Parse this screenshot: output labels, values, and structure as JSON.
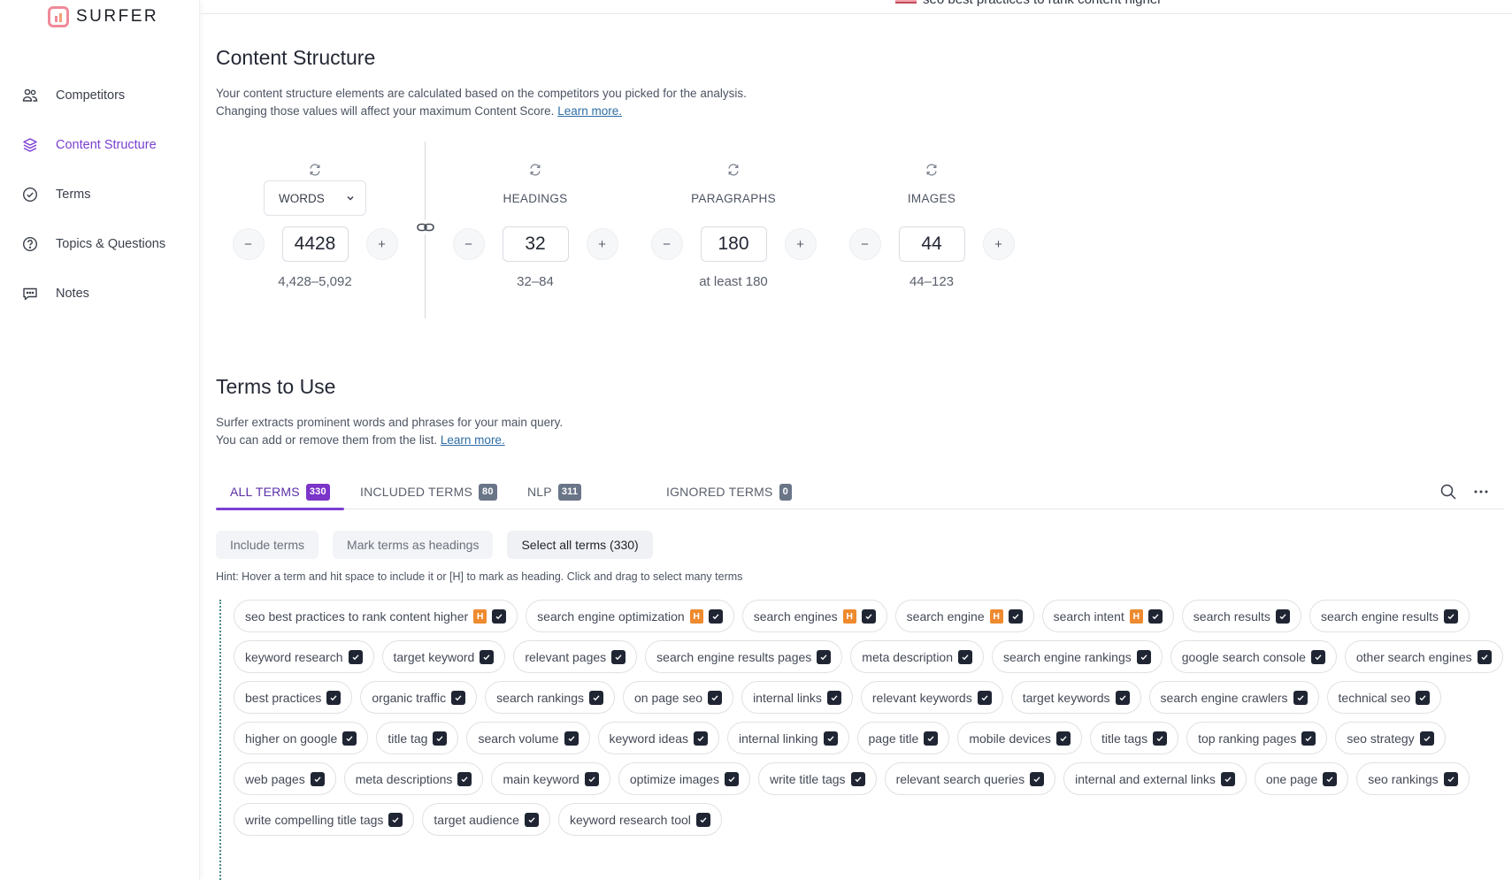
{
  "app": {
    "name": "SURFER"
  },
  "header": {
    "query": "seo best practices to rank content higher"
  },
  "sidebar": {
    "items": [
      {
        "label": "Competitors",
        "icon": "users-icon",
        "active": false
      },
      {
        "label": "Content Structure",
        "icon": "layers-icon",
        "active": true
      },
      {
        "label": "Terms",
        "icon": "check-circle-icon",
        "active": false
      },
      {
        "label": "Topics & Questions",
        "icon": "question-circle-icon",
        "active": false
      },
      {
        "label": "Notes",
        "icon": "chat-icon",
        "active": false
      }
    ]
  },
  "structure": {
    "title": "Content Structure",
    "desc_line1": "Your content structure elements are calculated based on the competitors you picked for the analysis.",
    "desc_line2": "Changing those values will affect your maximum Content Score.",
    "learn_more": "Learn more.",
    "metrics": [
      {
        "label": "WORDS",
        "is_select": true,
        "value": "4428",
        "range": "4,428–5,092"
      },
      {
        "label": "HEADINGS",
        "is_select": false,
        "value": "32",
        "range": "32–84"
      },
      {
        "label": "PARAGRAPHS",
        "is_select": false,
        "value": "180",
        "range": "at least 180"
      },
      {
        "label": "IMAGES",
        "is_select": false,
        "value": "44",
        "range": "44–123"
      }
    ],
    "minus": "−",
    "plus": "+"
  },
  "terms_section": {
    "title": "Terms to Use",
    "desc_line1": "Surfer extracts prominent words and phrases for your main query.",
    "desc_line2": "You can add or remove them from the list.",
    "learn_more": "Learn more.",
    "tabs": [
      {
        "label": "ALL TERMS",
        "count": "330",
        "active": true
      },
      {
        "label": "INCLUDED TERMS",
        "count": "80",
        "active": false
      },
      {
        "label": "NLP",
        "count": "311",
        "active": false
      },
      {
        "label": "IGNORED TERMS",
        "count": "0",
        "active": false
      }
    ],
    "actions": {
      "include": "Include terms",
      "mark_headings": "Mark terms as headings",
      "select_all": "Select all terms (330)"
    },
    "hint": "Hint: Hover a term and hit space to include it or [H] to mark as heading. Click and drag to select many terms",
    "heading_badge": "H",
    "terms": [
      {
        "text": "seo best practices to rank content higher",
        "heading": true,
        "checked": true
      },
      {
        "text": "search engine optimization",
        "heading": true,
        "checked": true
      },
      {
        "text": "search engines",
        "heading": true,
        "checked": true
      },
      {
        "text": "search engine",
        "heading": true,
        "checked": true
      },
      {
        "text": "search intent",
        "heading": true,
        "checked": true
      },
      {
        "text": "search results",
        "heading": false,
        "checked": true
      },
      {
        "text": "search engine results",
        "heading": false,
        "checked": true
      },
      {
        "text": "keyword research",
        "heading": false,
        "checked": true
      },
      {
        "text": "target keyword",
        "heading": false,
        "checked": true
      },
      {
        "text": "relevant pages",
        "heading": false,
        "checked": true
      },
      {
        "text": "search engine results pages",
        "heading": false,
        "checked": true
      },
      {
        "text": "meta description",
        "heading": false,
        "checked": true
      },
      {
        "text": "search engine rankings",
        "heading": false,
        "checked": true
      },
      {
        "text": "google search console",
        "heading": false,
        "checked": true
      },
      {
        "text": "other search engines",
        "heading": false,
        "checked": true
      },
      {
        "text": "best practices",
        "heading": false,
        "checked": true
      },
      {
        "text": "organic traffic",
        "heading": false,
        "checked": true
      },
      {
        "text": "search rankings",
        "heading": false,
        "checked": true
      },
      {
        "text": "on page seo",
        "heading": false,
        "checked": true
      },
      {
        "text": "internal links",
        "heading": false,
        "checked": true
      },
      {
        "text": "relevant keywords",
        "heading": false,
        "checked": true
      },
      {
        "text": "target keywords",
        "heading": false,
        "checked": true
      },
      {
        "text": "search engine crawlers",
        "heading": false,
        "checked": true
      },
      {
        "text": "technical seo",
        "heading": false,
        "checked": true
      },
      {
        "text": "higher on google",
        "heading": false,
        "checked": true
      },
      {
        "text": "title tag",
        "heading": false,
        "checked": true
      },
      {
        "text": "search volume",
        "heading": false,
        "checked": true
      },
      {
        "text": "keyword ideas",
        "heading": false,
        "checked": true
      },
      {
        "text": "internal linking",
        "heading": false,
        "checked": true
      },
      {
        "text": "page title",
        "heading": false,
        "checked": true
      },
      {
        "text": "mobile devices",
        "heading": false,
        "checked": true
      },
      {
        "text": "title tags",
        "heading": false,
        "checked": true
      },
      {
        "text": "top ranking pages",
        "heading": false,
        "checked": true
      },
      {
        "text": "seo strategy",
        "heading": false,
        "checked": true
      },
      {
        "text": "web pages",
        "heading": false,
        "checked": true
      },
      {
        "text": "meta descriptions",
        "heading": false,
        "checked": true
      },
      {
        "text": "main keyword",
        "heading": false,
        "checked": true
      },
      {
        "text": "optimize images",
        "heading": false,
        "checked": true
      },
      {
        "text": "write title tags",
        "heading": false,
        "checked": true
      },
      {
        "text": "relevant search queries",
        "heading": false,
        "checked": true
      },
      {
        "text": "internal and external links",
        "heading": false,
        "checked": true
      },
      {
        "text": "one page",
        "heading": false,
        "checked": true
      },
      {
        "text": "seo rankings",
        "heading": false,
        "checked": true
      },
      {
        "text": "write compelling title tags",
        "heading": false,
        "checked": true
      },
      {
        "text": "target audience",
        "heading": false,
        "checked": true
      },
      {
        "text": "keyword research tool",
        "heading": false,
        "checked": true
      }
    ]
  },
  "colors": {
    "accent": "#7b3fd1",
    "heading_badge": "#ef8a2e",
    "checkbox": "#1f2532",
    "link": "#2e6da4"
  }
}
